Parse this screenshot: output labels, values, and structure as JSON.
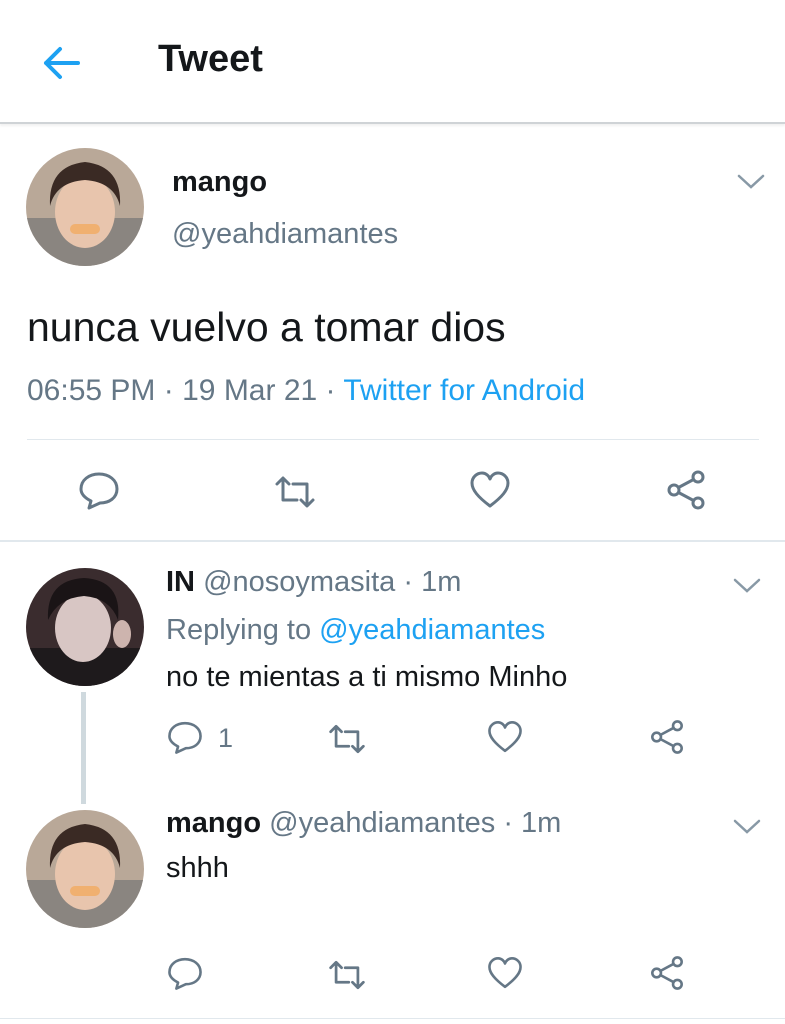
{
  "header": {
    "title": "Tweet",
    "back_icon": "arrow-left-icon"
  },
  "colors": {
    "accent": "#1da1f2",
    "secondary_text": "#657786",
    "divider": "#e1e8ed"
  },
  "main_tweet": {
    "name": "mango",
    "handle": "@yeahdiamantes",
    "text": "nunca vuelvo a tomar dios",
    "time": "06:55 PM",
    "date": "19 Mar 21",
    "separator": "·",
    "source": "Twitter for Android"
  },
  "replies": [
    {
      "name": "IN",
      "handle": "@nosoymasita",
      "separator": "·",
      "time": "1m",
      "replying_prefix": "Replying to",
      "replying_to": "@yeahdiamantes",
      "text": "no te mientas a ti mismo Minho",
      "reply_count": "1"
    },
    {
      "name": "mango",
      "handle": "@yeahdiamantes",
      "separator": "·",
      "time": "1m",
      "text": "shhh"
    }
  ]
}
